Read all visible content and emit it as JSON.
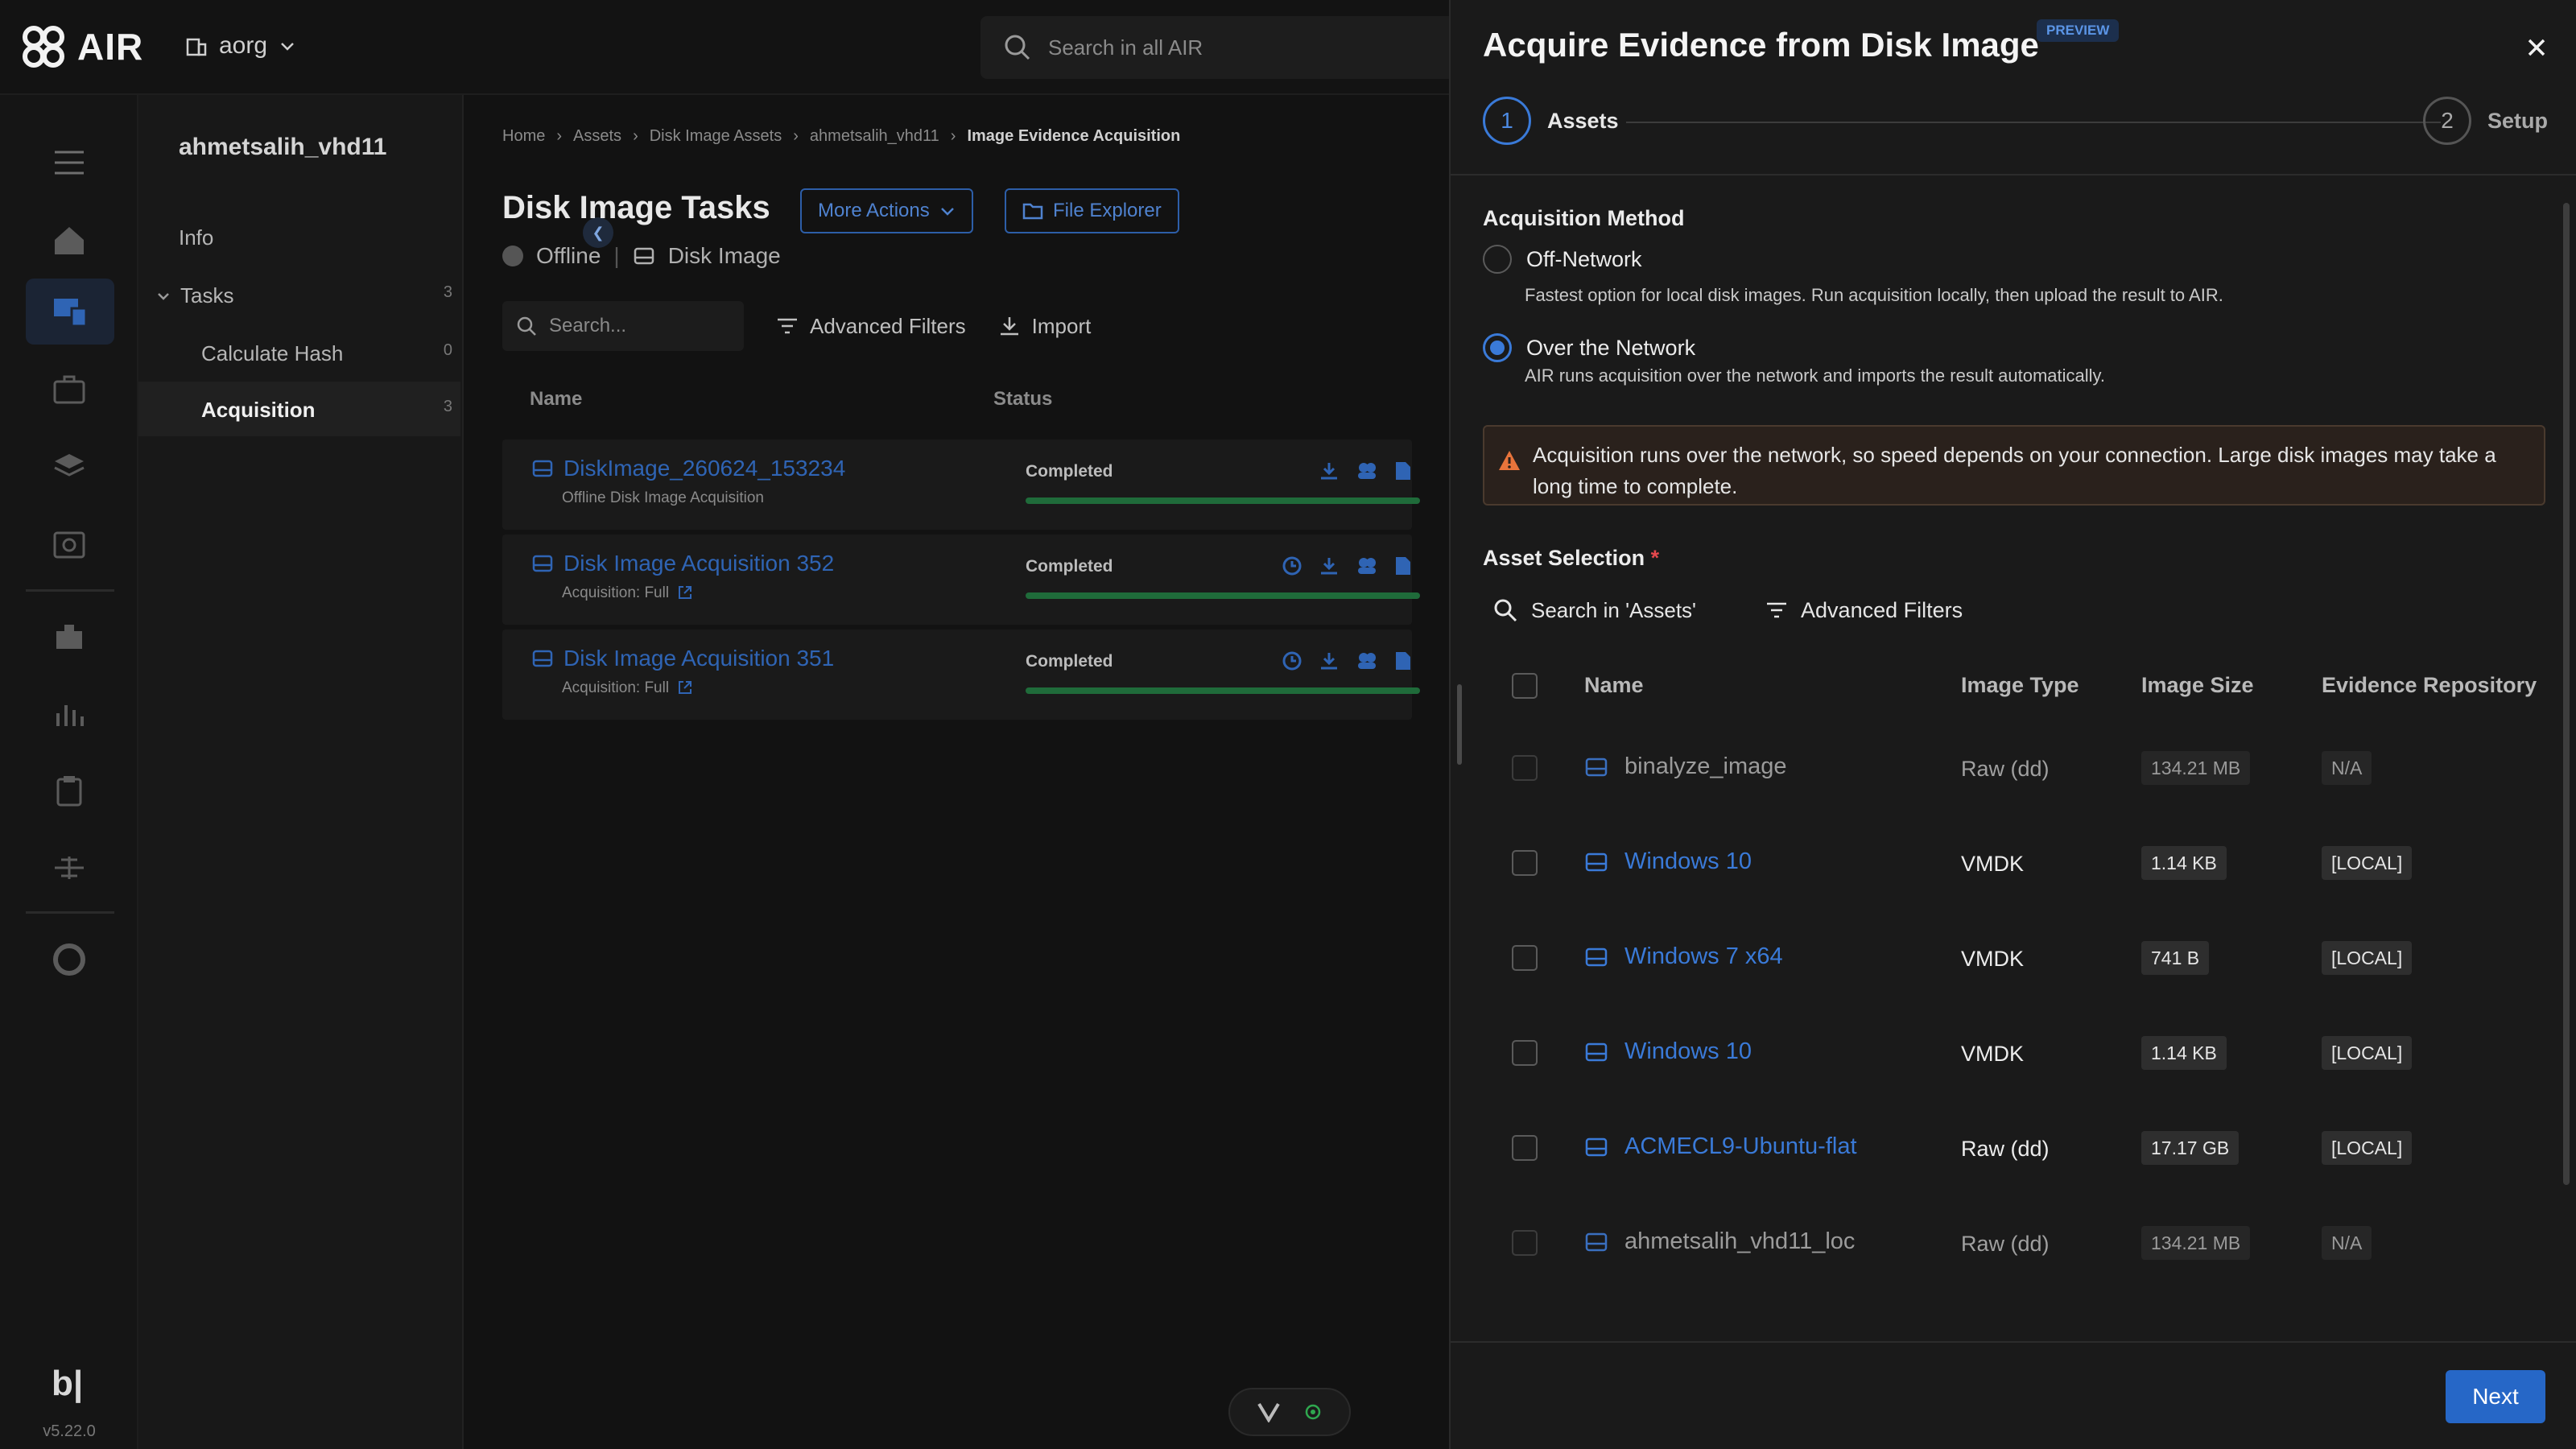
{
  "app": {
    "logo_text": "AIR",
    "org": "aorg",
    "search_placeholder": "Search in all AIR",
    "version": "v5.22.0",
    "footer_logo": "b|"
  },
  "subnav": {
    "title": "ahmetsalih_vhd11",
    "items": [
      {
        "label": "Info",
        "count": ""
      },
      {
        "label": "Tasks",
        "count": "3"
      },
      {
        "label": "Calculate Hash",
        "count": "0"
      },
      {
        "label": "Acquisition",
        "count": "3"
      }
    ]
  },
  "main": {
    "breadcrumb": [
      "Home",
      "Assets",
      "Disk Image Assets",
      "ahmetsalih_vhd11",
      "Image Evidence Acquisition"
    ],
    "title": "Disk Image Tasks",
    "more_actions": "More Actions",
    "file_explorer": "File Explorer",
    "status": "Offline",
    "asset_kind": "Disk Image",
    "search_placeholder": "Search...",
    "advanced_filters": "Advanced Filters",
    "import": "Import",
    "columns": [
      "Name",
      "Status"
    ],
    "tasks": [
      {
        "name": "DiskImage_260624_153234",
        "sub": "Offline Disk Image Acquisition",
        "status": "Completed"
      },
      {
        "name": "Disk Image Acquisition 352",
        "sub": "Acquisition: Full",
        "status": "Completed"
      },
      {
        "name": "Disk Image Acquisition 351",
        "sub": "Acquisition: Full",
        "status": "Completed"
      }
    ]
  },
  "drawer": {
    "title": "Acquire Evidence from Disk Image",
    "badge": "PREVIEW",
    "steps": [
      {
        "num": "1",
        "label": "Assets"
      },
      {
        "num": "2",
        "label": "Setup"
      }
    ],
    "acq_method_label": "Acquisition Method",
    "methods": [
      {
        "label": "Off-Network",
        "desc": "Fastest option for local disk images. Run acquisition locally, then upload the result to AIR.",
        "checked": false
      },
      {
        "label": "Over the Network",
        "desc": "AIR runs acquisition over the network and imports the result automatically.",
        "checked": true
      }
    ],
    "warning": "Acquisition runs over the network, so speed depends on your connection. Large disk images may take a long time to complete.",
    "asset_selection_label": "Asset Selection",
    "required_mark": "*",
    "asset_search_placeholder": "Search in 'Assets'",
    "advanced_filters": "Advanced Filters",
    "columns": [
      "Name",
      "Image Type",
      "Image Size",
      "Evidence Repository"
    ],
    "assets": [
      {
        "name": "binalyze_image",
        "type": "Raw (dd)",
        "size": "134.21 MB",
        "repo": "N/A",
        "enabled": false
      },
      {
        "name": "Windows 10",
        "type": "VMDK",
        "size": "1.14 KB",
        "repo": "[LOCAL]",
        "enabled": true
      },
      {
        "name": "Windows 7 x64",
        "type": "VMDK",
        "size": "741 B",
        "repo": "[LOCAL]",
        "enabled": true
      },
      {
        "name": "Windows 10",
        "type": "VMDK",
        "size": "1.14 KB",
        "repo": "[LOCAL]",
        "enabled": true
      },
      {
        "name": "ACMECL9-Ubuntu-flat",
        "type": "Raw (dd)",
        "size": "17.17 GB",
        "repo": "[LOCAL]",
        "enabled": true
      },
      {
        "name": "ahmetsalih_vhd11_loc",
        "type": "Raw (dd)",
        "size": "134.21 MB",
        "repo": "N/A",
        "enabled": false
      }
    ],
    "next": "Next"
  },
  "colors": {
    "accent": "#3a7ad8",
    "drawer_bg": "#1a1a1a",
    "warning_icon": "#e8743b",
    "success": "#1f6b3a"
  }
}
